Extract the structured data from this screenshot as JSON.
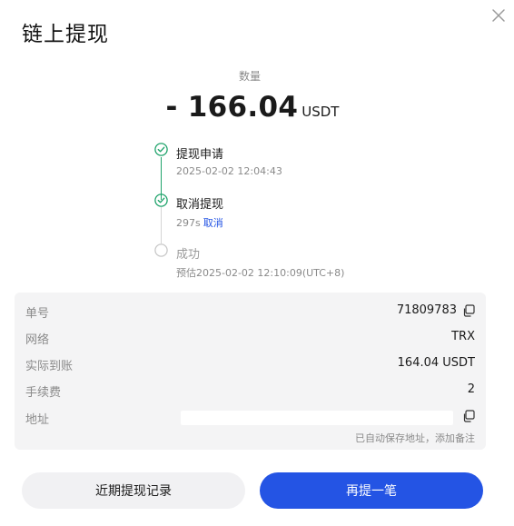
{
  "dialog": {
    "title": "链上提现"
  },
  "amount": {
    "label": "数量",
    "value": "- 166.04",
    "unit": "USDT"
  },
  "timeline": {
    "steps": [
      {
        "title": "提现申请",
        "subtitle": "2025-02-02 12:04:43",
        "status": "done"
      },
      {
        "title": "取消提现",
        "subtitle": "297s",
        "action": "取消",
        "status": "done"
      },
      {
        "title": "成功",
        "subtitle": "预估2025-02-02 12:10:09(UTC+8)",
        "status": "pending"
      }
    ]
  },
  "details": {
    "order_no": {
      "label": "单号",
      "value": "71809783"
    },
    "network": {
      "label": "网络",
      "value": "TRX"
    },
    "received": {
      "label": "实际到账",
      "value": "164.04 USDT"
    },
    "fee": {
      "label": "手续费",
      "value": "2"
    },
    "address": {
      "label": "地址",
      "note": "已自动保存地址，",
      "note_link": "添加备注"
    }
  },
  "buttons": {
    "history": "近期提现记录",
    "withdraw_again": "再提一笔"
  },
  "colors": {
    "success": "#1fa36b",
    "primary": "#2454e4",
    "pending": "#c8c8c8"
  }
}
